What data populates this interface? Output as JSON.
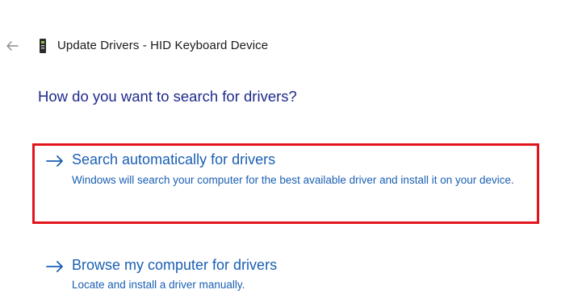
{
  "window": {
    "title": "Update Drivers - HID Keyboard Device",
    "back_icon": "back-arrow-icon",
    "device_icon": "device-icon"
  },
  "main": {
    "question": "How do you want to search for drivers?",
    "options": [
      {
        "title": "Search automatically for drivers",
        "description": "Windows will search your computer for the best available driver and install it on your device.",
        "highlighted": true,
        "highlight_color": "#e2141b"
      },
      {
        "title": "Browse my computer for drivers",
        "description": "Locate and install a driver manually."
      }
    ]
  },
  "colors": {
    "heading": "#1f2a8c",
    "link": "#1a5fb4",
    "highlight": "#e2141b"
  }
}
